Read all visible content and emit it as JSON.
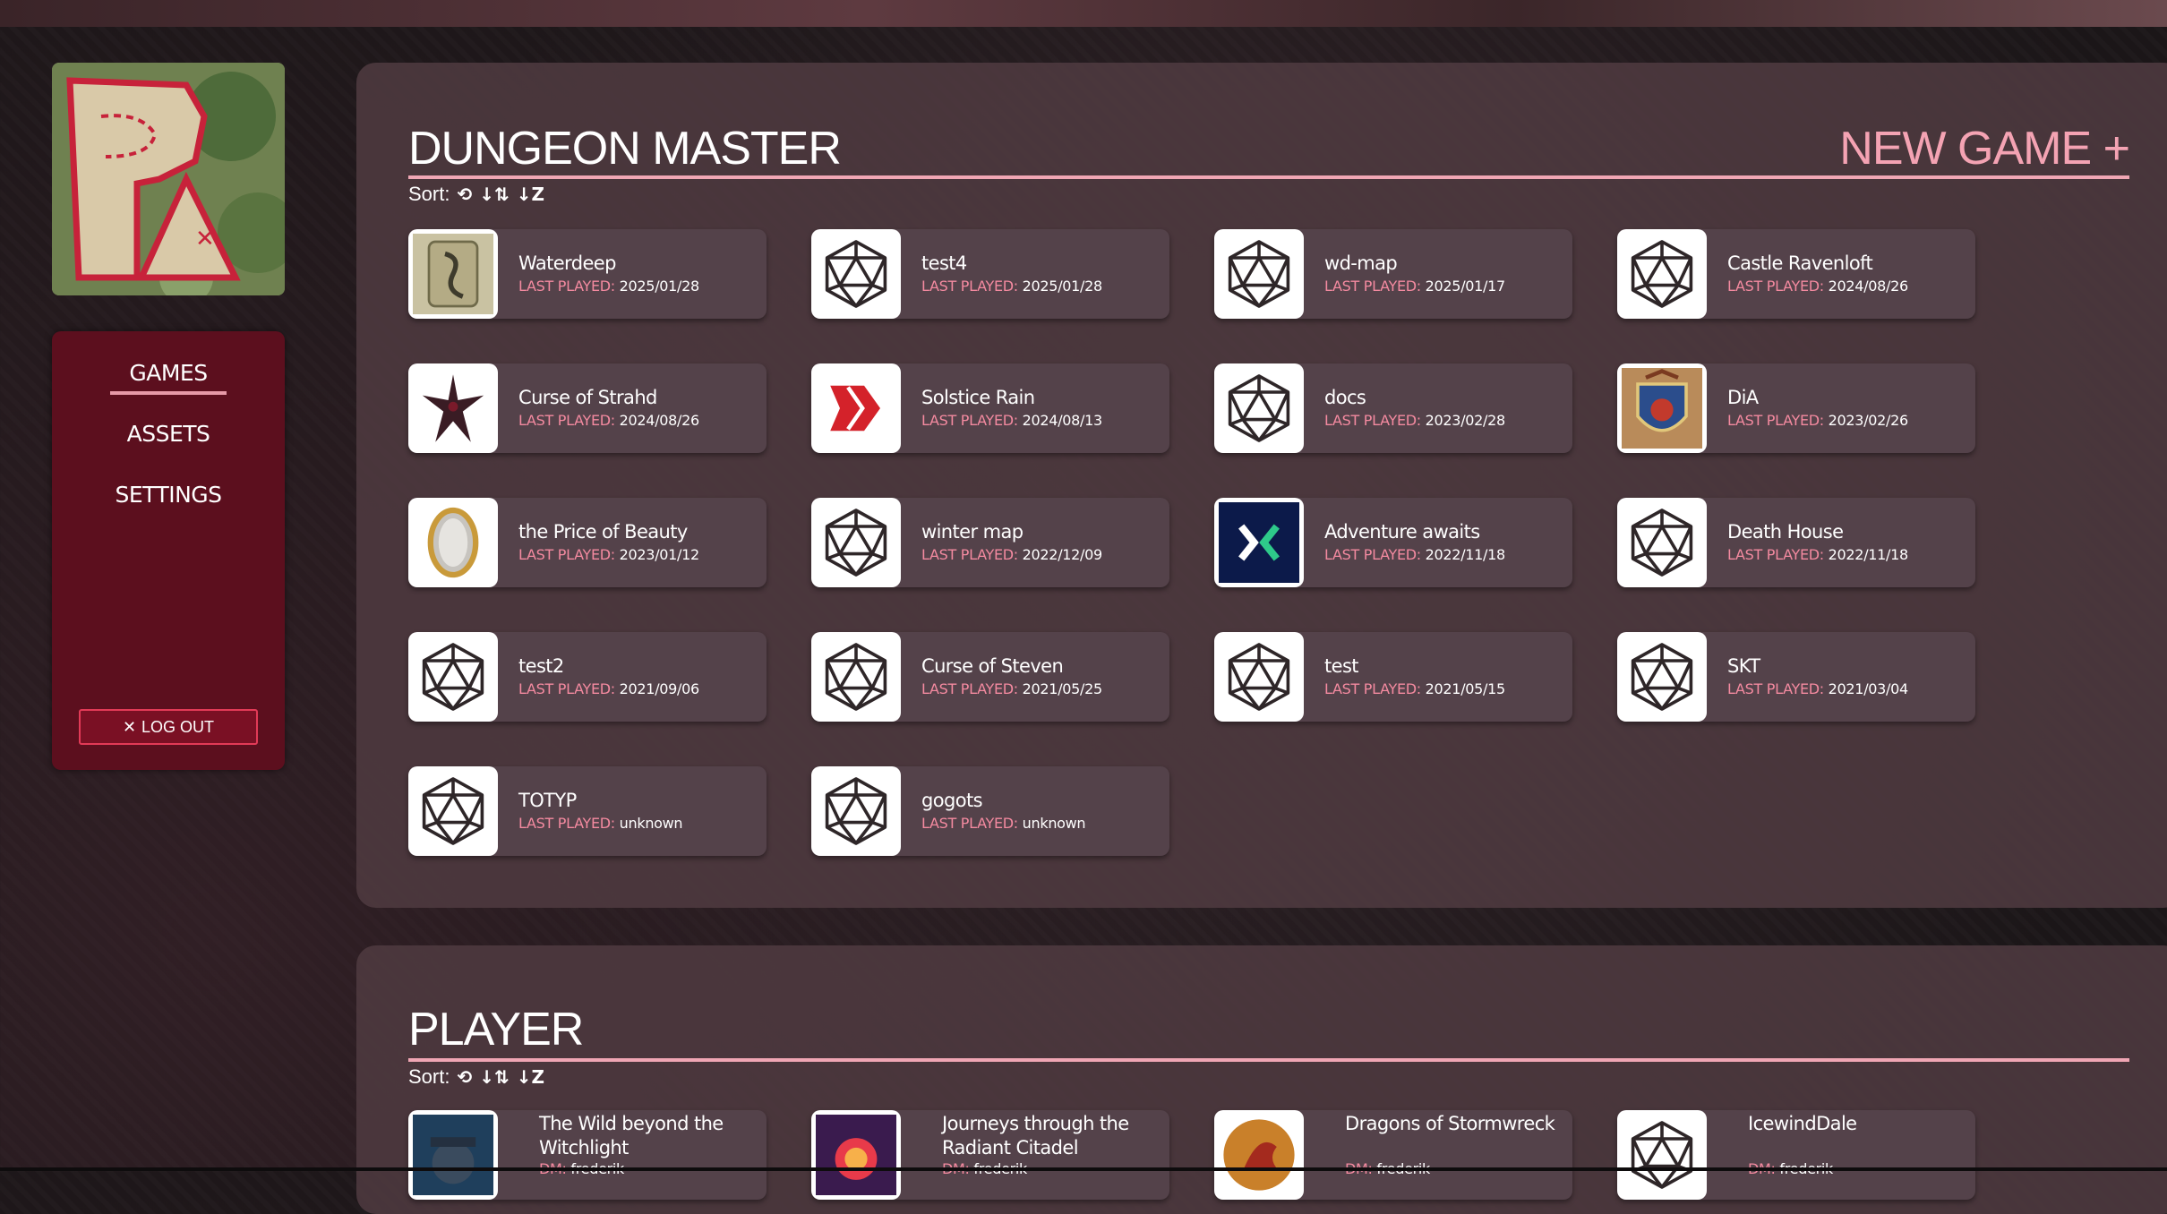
{
  "nav": {
    "items": [
      {
        "label": "GAMES",
        "active": true
      },
      {
        "label": "ASSETS",
        "active": false
      },
      {
        "label": "SETTINGS",
        "active": false
      }
    ],
    "logout_label": "LOG OUT"
  },
  "logo": {
    "text": "PA"
  },
  "dm": {
    "title": "DUNGEON MASTER",
    "new_game_label": "NEW GAME +",
    "sort_label": "Sort:",
    "last_played_label": "LAST PLAYED:",
    "games": [
      {
        "name": "Waterdeep",
        "last_played": "2025/01/28",
        "icon": "waterdeep-art-icon"
      },
      {
        "name": "test4",
        "last_played": "2025/01/28",
        "icon": "d20-icon"
      },
      {
        "name": "wd-map",
        "last_played": "2025/01/17",
        "icon": "d20-icon"
      },
      {
        "name": "Castle Ravenloft",
        "last_played": "2024/08/26",
        "icon": "d20-icon"
      },
      {
        "name": "Curse of Strahd",
        "last_played": "2024/08/26",
        "icon": "strahd-bat-icon"
      },
      {
        "name": "Solstice Rain",
        "last_played": "2024/08/13",
        "icon": "red-chevron-icon"
      },
      {
        "name": "docs",
        "last_played": "2023/02/28",
        "icon": "d20-icon"
      },
      {
        "name": "DiA",
        "last_played": "2023/02/26",
        "icon": "crest-icon"
      },
      {
        "name": "the Price of Beauty",
        "last_played": "2023/01/12",
        "icon": "mirror-icon"
      },
      {
        "name": "winter map",
        "last_played": "2022/12/09",
        "icon": "d20-icon"
      },
      {
        "name": "Adventure awaits",
        "last_played": "2022/11/18",
        "icon": "brackets-logo-icon"
      },
      {
        "name": "Death House",
        "last_played": "2022/11/18",
        "icon": "d20-icon"
      },
      {
        "name": "test2",
        "last_played": "2021/09/06",
        "icon": "d20-icon"
      },
      {
        "name": "Curse of Steven",
        "last_played": "2021/05/25",
        "icon": "d20-icon"
      },
      {
        "name": "test",
        "last_played": "2021/05/15",
        "icon": "d20-icon"
      },
      {
        "name": "SKT",
        "last_played": "2021/03/04",
        "icon": "d20-icon"
      },
      {
        "name": "TOTYP",
        "last_played": "unknown",
        "icon": "d20-icon"
      },
      {
        "name": "gogots",
        "last_played": "unknown",
        "icon": "d20-icon"
      }
    ]
  },
  "player": {
    "title": "PLAYER",
    "sort_label": "Sort:",
    "dm_label": "DM:",
    "games": [
      {
        "name": "The Wild beyond the Witchlight",
        "dm": "frederik",
        "icon": "witchlight-art-icon"
      },
      {
        "name": "Journeys through the Radiant Citadel",
        "dm": "frederik",
        "icon": "radiant-art-icon"
      },
      {
        "name": "Dragons of Stormwreck",
        "dm": "frederik",
        "icon": "dragon-art-icon"
      },
      {
        "name": "IcewindDale",
        "dm": "frederik",
        "icon": "d20-icon"
      }
    ]
  },
  "colors": {
    "accent": "#f4a3b3",
    "label_pink": "#f48aa0",
    "nav_bg": "#5c0f1e",
    "panel_bg": "#4e3a40",
    "card_bg": "#54424a"
  }
}
